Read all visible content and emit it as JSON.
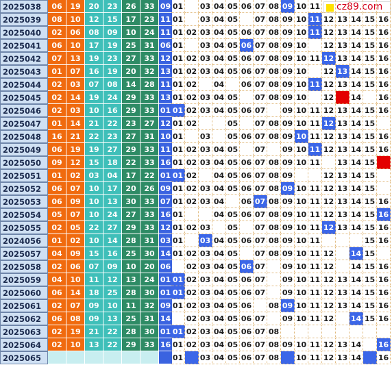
{
  "site_logo": "cz89.com",
  "colors": {
    "red_ball": "#f06a0e",
    "red_ball_mid": "#3fbfb9",
    "red_ball_teal": "#2e8b65",
    "blue_ball": "#3a63e0",
    "issue_bg": "#cfe0f3",
    "grid_line": "#e0b87a",
    "highlight": "#3b66e8",
    "marker_red": "#e30000"
  },
  "rows": [
    {
      "issue": "2025038",
      "reds": [
        "06",
        "19",
        "20",
        "23",
        "26",
        "33"
      ],
      "blue": "09",
      "nums": [
        "01",
        "",
        "03",
        "04",
        "05",
        "06",
        "07",
        "08",
        "09",
        "10",
        "11",
        "",
        "",
        "",
        "",
        ""
      ],
      "hl": [
        8
      ],
      "mk": []
    },
    {
      "issue": "2025039",
      "reds": [
        "08",
        "10",
        "12",
        "15",
        "17",
        "23"
      ],
      "blue": "11",
      "nums": [
        "01",
        "",
        "03",
        "04",
        "05",
        "",
        "07",
        "08",
        "09",
        "10",
        "11",
        "12",
        "13",
        "14",
        "15",
        "16"
      ],
      "hl": [
        10
      ],
      "mk": []
    },
    {
      "issue": "2025040",
      "reds": [
        "02",
        "06",
        "08",
        "09",
        "10",
        "24"
      ],
      "blue": "11",
      "nums": [
        "01",
        "02",
        "03",
        "04",
        "05",
        "06",
        "07",
        "08",
        "09",
        "10",
        "11",
        "12",
        "13",
        "14",
        "15",
        "16"
      ],
      "hl": [
        10
      ],
      "mk": []
    },
    {
      "issue": "2025041",
      "reds": [
        "06",
        "10",
        "17",
        "19",
        "25",
        "31"
      ],
      "blue": "06",
      "nums": [
        "01",
        "",
        "03",
        "04",
        "05",
        "06",
        "07",
        "08",
        "09",
        "10",
        "",
        "12",
        "13",
        "14",
        "15",
        "16"
      ],
      "hl": [
        5
      ],
      "mk": []
    },
    {
      "issue": "2025042",
      "reds": [
        "07",
        "13",
        "19",
        "23",
        "27",
        "33"
      ],
      "blue": "12",
      "nums": [
        "01",
        "02",
        "03",
        "04",
        "05",
        "06",
        "07",
        "08",
        "09",
        "10",
        "11",
        "12",
        "13",
        "14",
        "15",
        "16"
      ],
      "hl": [
        11
      ],
      "mk": []
    },
    {
      "issue": "2025043",
      "reds": [
        "01",
        "07",
        "16",
        "19",
        "20",
        "32"
      ],
      "blue": "13",
      "nums": [
        "01",
        "02",
        "03",
        "04",
        "05",
        "06",
        "07",
        "08",
        "09",
        "10",
        "",
        "12",
        "13",
        "14",
        "15",
        "16"
      ],
      "hl": [
        12
      ],
      "mk": []
    },
    {
      "issue": "2025044",
      "reds": [
        "02",
        "03",
        "07",
        "08",
        "14",
        "28"
      ],
      "blue": "11",
      "nums": [
        "01",
        "02",
        "",
        "04",
        "",
        "06",
        "07",
        "08",
        "09",
        "10",
        "11",
        "12",
        "13",
        "14",
        "15",
        "16"
      ],
      "hl": [
        10
      ],
      "mk": []
    },
    {
      "issue": "2025045",
      "reds": [
        "02",
        "14",
        "19",
        "24",
        "29",
        "33"
      ],
      "blue": "13",
      "nums": [
        "01",
        "02",
        "03",
        "04",
        "05",
        "",
        "07",
        "08",
        "09",
        "10",
        "",
        "12",
        "",
        "14",
        "",
        "16"
      ],
      "hl": [],
      "mk": [
        12
      ]
    },
    {
      "issue": "2025046",
      "reds": [
        "02",
        "03",
        "10",
        "16",
        "29",
        "33"
      ],
      "blue": "01",
      "nums": [
        "01",
        "02",
        "03",
        "04",
        "05",
        "06",
        "07",
        "",
        "09",
        "10",
        "11",
        "12",
        "13",
        "14",
        "15",
        "16"
      ],
      "hl": [
        0
      ],
      "mk": []
    },
    {
      "issue": "2025047",
      "reds": [
        "01",
        "14",
        "21",
        "22",
        "23",
        "27"
      ],
      "blue": "12",
      "nums": [
        "01",
        "02",
        "",
        "",
        "05",
        "",
        "07",
        "08",
        "09",
        "10",
        "11",
        "12",
        "13",
        "14",
        "15",
        ""
      ],
      "hl": [
        11
      ],
      "mk": []
    },
    {
      "issue": "2025048",
      "reds": [
        "16",
        "21",
        "22",
        "23",
        "27",
        "31"
      ],
      "blue": "10",
      "nums": [
        "01",
        "",
        "03",
        "",
        "05",
        "06",
        "07",
        "08",
        "09",
        "10",
        "11",
        "12",
        "13",
        "14",
        "15",
        "16"
      ],
      "hl": [
        9
      ],
      "mk": []
    },
    {
      "issue": "2025049",
      "reds": [
        "06",
        "19",
        "19",
        "27",
        "29",
        "33"
      ],
      "blue": "11",
      "nums": [
        "01",
        "02",
        "03",
        "04",
        "05",
        "",
        "07",
        "",
        "09",
        "10",
        "11",
        "12",
        "13",
        "14",
        "15",
        "16"
      ],
      "hl": [
        10
      ],
      "mk": []
    },
    {
      "issue": "2025050",
      "reds": [
        "09",
        "12",
        "15",
        "18",
        "22",
        "33"
      ],
      "blue": "16",
      "nums": [
        "01",
        "02",
        "03",
        "04",
        "05",
        "06",
        "07",
        "08",
        "09",
        "10",
        "11",
        "",
        "13",
        "14",
        "15",
        ""
      ],
      "hl": [],
      "mk": [
        15
      ]
    },
    {
      "issue": "2025051",
      "reds": [
        "01",
        "02",
        "03",
        "04",
        "17",
        "22"
      ],
      "blue": "01",
      "nums": [
        "01",
        "02",
        "",
        "04",
        "05",
        "06",
        "07",
        "08",
        "09",
        "",
        "",
        "12",
        "13",
        "14",
        "15",
        ""
      ],
      "hl": [
        0
      ],
      "mk": []
    },
    {
      "issue": "2025052",
      "reds": [
        "06",
        "07",
        "10",
        "17",
        "20",
        "26"
      ],
      "blue": "09",
      "nums": [
        "01",
        "02",
        "03",
        "04",
        "05",
        "06",
        "07",
        "08",
        "09",
        "10",
        "11",
        "12",
        "13",
        "14",
        "15",
        ""
      ],
      "hl": [
        8
      ],
      "mk": []
    },
    {
      "issue": "2025053",
      "reds": [
        "06",
        "09",
        "10",
        "13",
        "30",
        "33"
      ],
      "blue": "07",
      "nums": [
        "01",
        "02",
        "03",
        "04",
        "",
        "06",
        "07",
        "08",
        "09",
        "10",
        "11",
        "12",
        "13",
        "14",
        "15",
        "16"
      ],
      "hl": [
        6
      ],
      "mk": []
    },
    {
      "issue": "2025054",
      "reds": [
        "05",
        "07",
        "10",
        "24",
        "27",
        "33"
      ],
      "blue": "16",
      "nums": [
        "01",
        "",
        "",
        "04",
        "05",
        "06",
        "07",
        "08",
        "09",
        "10",
        "11",
        "12",
        "13",
        "14",
        "15",
        "16"
      ],
      "hl": [
        15
      ],
      "mk": []
    },
    {
      "issue": "2025055",
      "reds": [
        "02",
        "05",
        "22",
        "27",
        "29",
        "33"
      ],
      "blue": "12",
      "nums": [
        "01",
        "02",
        "03",
        "",
        "05",
        "",
        "07",
        "08",
        "09",
        "10",
        "11",
        "12",
        "13",
        "14",
        "15",
        "16"
      ],
      "hl": [
        11
      ],
      "mk": []
    },
    {
      "issue": "2024056",
      "reds": [
        "01",
        "02",
        "10",
        "14",
        "28",
        "31"
      ],
      "blue": "03",
      "nums": [
        "01",
        "",
        "03",
        "04",
        "05",
        "06",
        "07",
        "08",
        "09",
        "10",
        "11",
        "",
        "",
        "",
        "15",
        "16"
      ],
      "hl": [
        2
      ],
      "mk": []
    },
    {
      "issue": "2025057",
      "reds": [
        "04",
        "09",
        "15",
        "16",
        "25",
        "30"
      ],
      "blue": "14",
      "nums": [
        "01",
        "02",
        "03",
        "04",
        "05",
        "",
        "07",
        "08",
        "09",
        "10",
        "11",
        "12",
        "",
        "14",
        "15",
        ""
      ],
      "hl": [
        13
      ],
      "mk": []
    },
    {
      "issue": "2025058",
      "reds": [
        "02",
        "06",
        "07",
        "09",
        "10",
        "20"
      ],
      "blue": "06",
      "nums": [
        "",
        "02",
        "03",
        "04",
        "05",
        "06",
        "07",
        "",
        "09",
        "10",
        "11",
        "12",
        "",
        "14",
        "15",
        "16"
      ],
      "hl": [
        5
      ],
      "mk": []
    },
    {
      "issue": "2025059",
      "reds": [
        "04",
        "10",
        "11",
        "12",
        "13",
        "24"
      ],
      "blue": "01",
      "nums": [
        "01",
        "02",
        "03",
        "04",
        "05",
        "06",
        "07",
        "",
        "09",
        "10",
        "11",
        "12",
        "13",
        "14",
        "15",
        "16"
      ],
      "hl": [
        0
      ],
      "mk": []
    },
    {
      "issue": "2025060",
      "reds": [
        "06",
        "14",
        "18",
        "25",
        "28",
        "30"
      ],
      "blue": "01",
      "nums": [
        "01",
        "02",
        "03",
        "04",
        "05",
        "06",
        "07",
        "",
        "09",
        "10",
        "11",
        "12",
        "13",
        "14",
        "15",
        "16"
      ],
      "hl": [
        0
      ],
      "mk": []
    },
    {
      "issue": "2025061",
      "reds": [
        "02",
        "07",
        "09",
        "10",
        "11",
        "32"
      ],
      "blue": "09",
      "nums": [
        "01",
        "02",
        "03",
        "04",
        "05",
        "06",
        "",
        "08",
        "09",
        "10",
        "11",
        "12",
        "13",
        "14",
        "15",
        "16"
      ],
      "hl": [
        8
      ],
      "mk": []
    },
    {
      "issue": "2025062",
      "reds": [
        "06",
        "08",
        "09",
        "13",
        "25",
        "31"
      ],
      "blue": "14",
      "nums": [
        "",
        "02",
        "03",
        "04",
        "05",
        "06",
        "07",
        "",
        "09",
        "10",
        "11",
        "12",
        "",
        "14",
        "15",
        "16"
      ],
      "hl": [
        13
      ],
      "mk": []
    },
    {
      "issue": "2025063",
      "reds": [
        "02",
        "19",
        "21",
        "22",
        "28",
        "30"
      ],
      "blue": "01",
      "nums": [
        "01",
        "02",
        "03",
        "04",
        "05",
        "06",
        "07",
        "08",
        "",
        "",
        "",
        "",
        "",
        "",
        "",
        ""
      ],
      "hl": [
        0
      ],
      "mk": []
    },
    {
      "issue": "2025064",
      "reds": [
        "02",
        "10",
        "13",
        "22",
        "29",
        "33"
      ],
      "blue": "16",
      "nums": [
        "01",
        "02",
        "03",
        "04",
        "05",
        "06",
        "07",
        "08",
        "09",
        "10",
        "11",
        "12",
        "13",
        "14",
        "",
        "16"
      ],
      "hl": [
        15
      ],
      "mk": []
    },
    {
      "issue": "2025065",
      "reds": [
        "",
        "",
        "",
        "",
        "",
        ""
      ],
      "blue": "",
      "nums": [
        "01",
        "",
        "03",
        "04",
        "05",
        "06",
        "07",
        "08",
        "",
        "10",
        "11",
        "12",
        "13",
        "14",
        "",
        "16"
      ],
      "hl": [
        1,
        8,
        14
      ],
      "mk": []
    }
  ]
}
